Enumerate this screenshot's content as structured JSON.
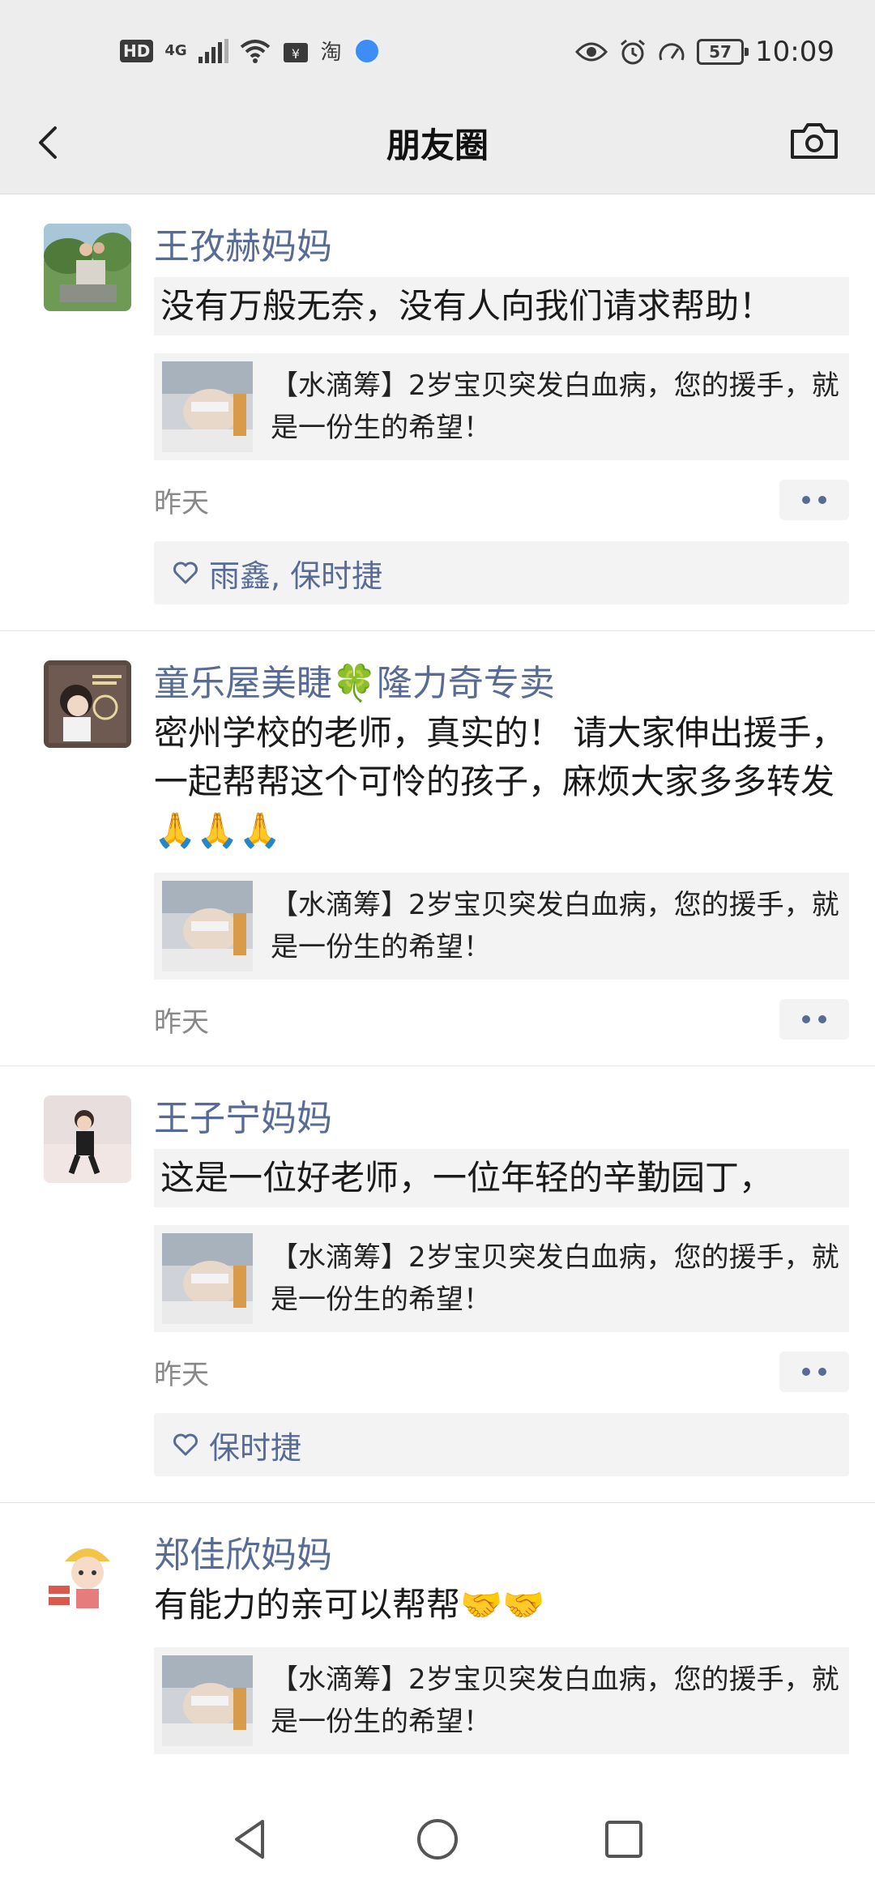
{
  "status_bar": {
    "hd": "HD",
    "network": "4G",
    "taobao": "淘",
    "battery": "57",
    "time": "10:09"
  },
  "nav": {
    "title": "朋友圈"
  },
  "posts": [
    {
      "nickname": "王孜赫妈妈",
      "text": "没有万般无奈，没有人向我们请求帮助！",
      "link_title": "【水滴筹】2岁宝贝突发白血病，您的援手，就是一份生的希望！",
      "time": "昨天",
      "likes": "雨鑫, 保时捷"
    },
    {
      "nickname": "童乐屋美睫🍀隆力奇专卖",
      "text": "密州学校的老师，真实的！ 请大家伸出援手，一起帮帮这个可怜的孩子，麻烦大家多多转发🙏🙏🙏",
      "link_title": "【水滴筹】2岁宝贝突发白血病，您的援手，就是一份生的希望！",
      "time": "昨天"
    },
    {
      "nickname": "王子宁妈妈",
      "text": "这是一位好老师，一位年轻的辛勤园丁，",
      "link_title": "【水滴筹】2岁宝贝突发白血病，您的援手，就是一份生的希望！",
      "time": "昨天",
      "likes": "保时捷"
    },
    {
      "nickname": "郑佳欣妈妈",
      "text": "有能力的亲可以帮帮🤝🤝",
      "link_title": "【水滴筹】2岁宝贝突发白血病，您的援手，就是一份生的希望！"
    }
  ],
  "colors": {
    "nickname": "#576b95",
    "bar_bg": "#ededed",
    "card_bg": "#f3f3f3"
  }
}
